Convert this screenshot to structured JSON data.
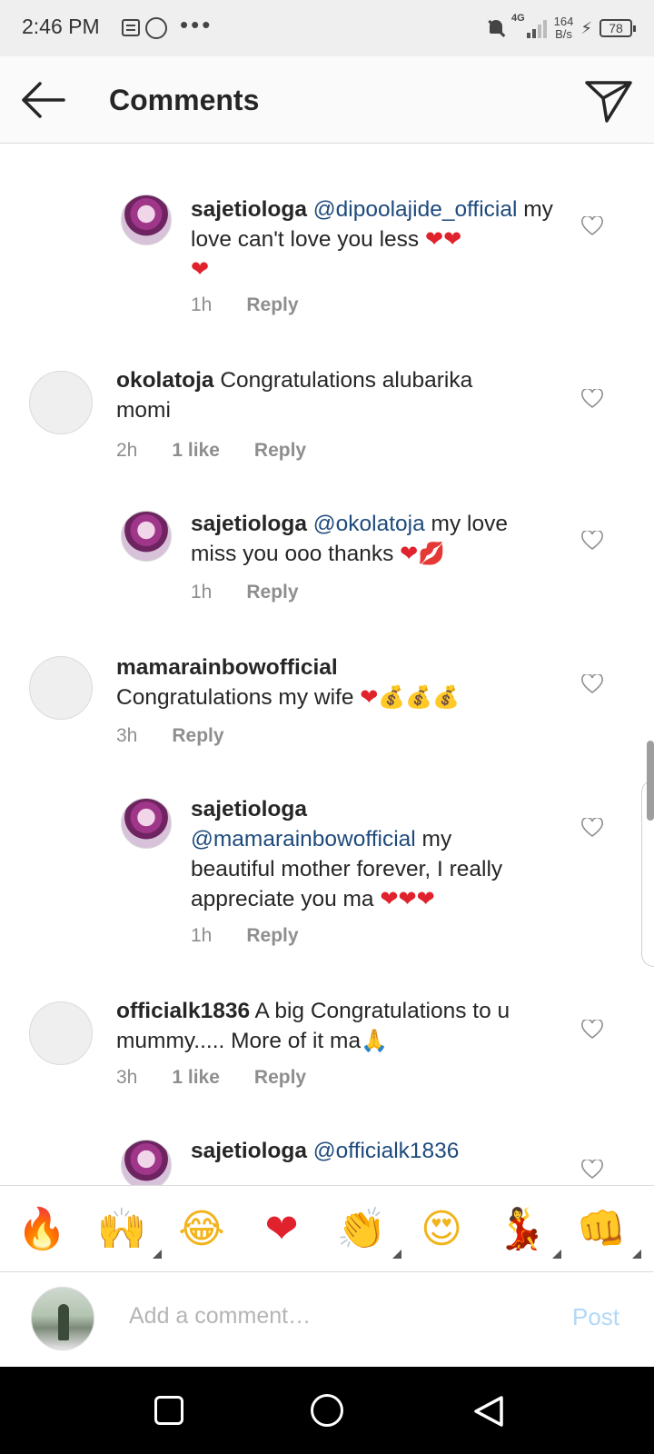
{
  "status_bar": {
    "time": "2:46 PM",
    "network": "4G",
    "speed_value": "164",
    "speed_unit": "B/s",
    "battery": "78",
    "icons": [
      "message-icon",
      "whatsapp-icon",
      "more-dots-icon",
      "mute-icon",
      "signal-icon",
      "charging-icon",
      "battery-icon"
    ]
  },
  "header": {
    "title": "Comments",
    "back_icon": "arrow-left-icon",
    "share_icon": "paper-plane-icon"
  },
  "comments": [
    {
      "username": "sajetiologa",
      "mention": "@dipoolajide_official",
      "text": " my love can't love you less ",
      "emojis": "❤❤",
      "text_line2": "❤",
      "time": "1h",
      "likes": "",
      "reply": "Reply",
      "is_reply": true
    },
    {
      "username": "okolatoja",
      "mention": "",
      "text": " Congratulations alubarika",
      "text_line2": "momi",
      "time": "2h",
      "likes": "1 like",
      "reply": "Reply",
      "is_reply": false
    },
    {
      "username": "sajetiologa",
      "mention": "@okolatoja",
      "text": " my love",
      "text_line2": "miss you ooo thanks ",
      "emojis": "❤💋",
      "time": "1h",
      "likes": "",
      "reply": "Reply",
      "is_reply": true
    },
    {
      "username": "mamarainbowofficial",
      "text_line2": "Congratulations my wife ",
      "emojis": "❤💰💰💰",
      "time": "3h",
      "likes": "",
      "reply": "Reply",
      "is_reply": false
    },
    {
      "username": "sajetiologa",
      "mention": "@mamarainbowofficial",
      "text": " my",
      "text_line3": "beautiful mother forever, I really",
      "text_line4": "appreciate you ma ",
      "emojis": "❤❤❤",
      "time": "1h",
      "likes": "",
      "reply": "Reply",
      "is_reply": true
    },
    {
      "username": "officialk1836",
      "text": " A big Congratulations to u",
      "text_line2": "mummy..... More of it ma",
      "emojis": "🙏",
      "time": "3h",
      "likes": "1 like",
      "reply": "Reply",
      "is_reply": false
    },
    {
      "username": "sajetiologa",
      "mention": "@officialk1836",
      "is_reply": true
    }
  ],
  "emoji_bar": {
    "items": [
      "🔥",
      "🙌",
      "😂",
      "❤",
      "👏",
      "😍",
      "💃",
      "👊"
    ],
    "names": [
      "fire-emoji",
      "raising-hands-emoji",
      "tears-of-joy-emoji",
      "red-heart-emoji",
      "clapping-emoji",
      "heart-eyes-emoji",
      "dancer-emoji",
      "fist-emoji"
    ]
  },
  "composer": {
    "placeholder": "Add a comment…",
    "post_label": "Post"
  },
  "colors": {
    "mention": "#1e4a7c",
    "meta": "#8e8e8e",
    "post_disabled": "#b3d8f5",
    "heart_emoji": "#e0222c"
  }
}
